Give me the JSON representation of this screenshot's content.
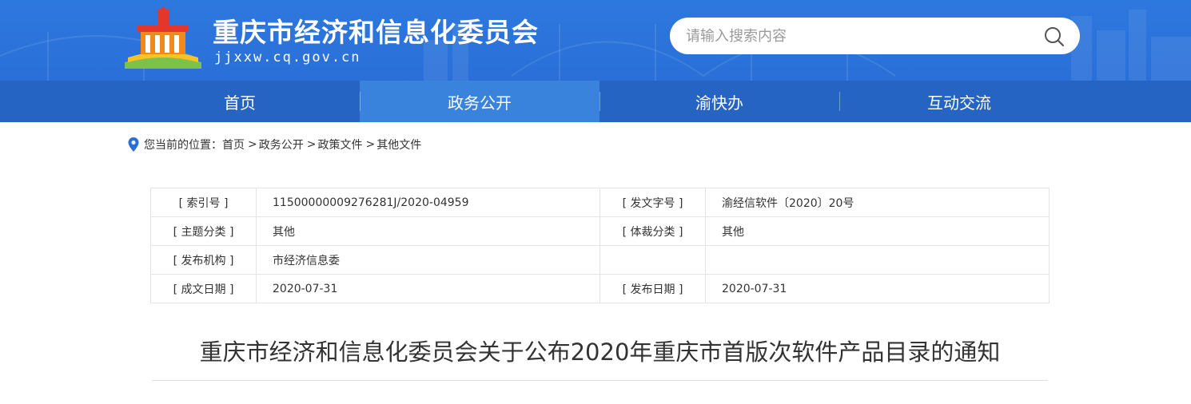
{
  "header": {
    "site_title": "重庆市经济和信息化委员会",
    "site_domain": "jjxxw.cq.gov.cn",
    "search_placeholder": "请输入搜索内容",
    "search_icon": "search-icon",
    "colors": {
      "header_bg": "#2d78de",
      "nav_bg": "#2664c4",
      "nav_active": "#3a83dd"
    }
  },
  "nav": {
    "items": [
      {
        "label": "首页"
      },
      {
        "label": "政务公开"
      },
      {
        "label": "渝快办"
      },
      {
        "label": "互动交流"
      }
    ],
    "active_index": 1
  },
  "breadcrumb": {
    "prefix": "您当前的位置：",
    "items": [
      "首页",
      "政务公开",
      "政策文件",
      "其他文件"
    ],
    "separator": ">"
  },
  "meta": {
    "rows": [
      {
        "label1": "[ 索引号 ]",
        "value1": "11500000009276281J/2020-04959",
        "label2": "[ 发文字号 ]",
        "value2": "渝经信软件〔2020〕20号"
      },
      {
        "label1": "[ 主题分类 ]",
        "value1": "其他",
        "label2": "[ 体裁分类 ]",
        "value2": "其他"
      },
      {
        "label1": "[ 发布机构 ]",
        "value1": "市经济信息委",
        "label2": "",
        "value2": ""
      },
      {
        "label1": "[ 成文日期 ]",
        "value1": "2020-07-31",
        "label2": "[ 发布日期 ]",
        "value2": "2020-07-31"
      }
    ]
  },
  "document": {
    "title": "重庆市经济和信息化委员会关于公布2020年重庆市首版次软件产品目录的通知"
  }
}
